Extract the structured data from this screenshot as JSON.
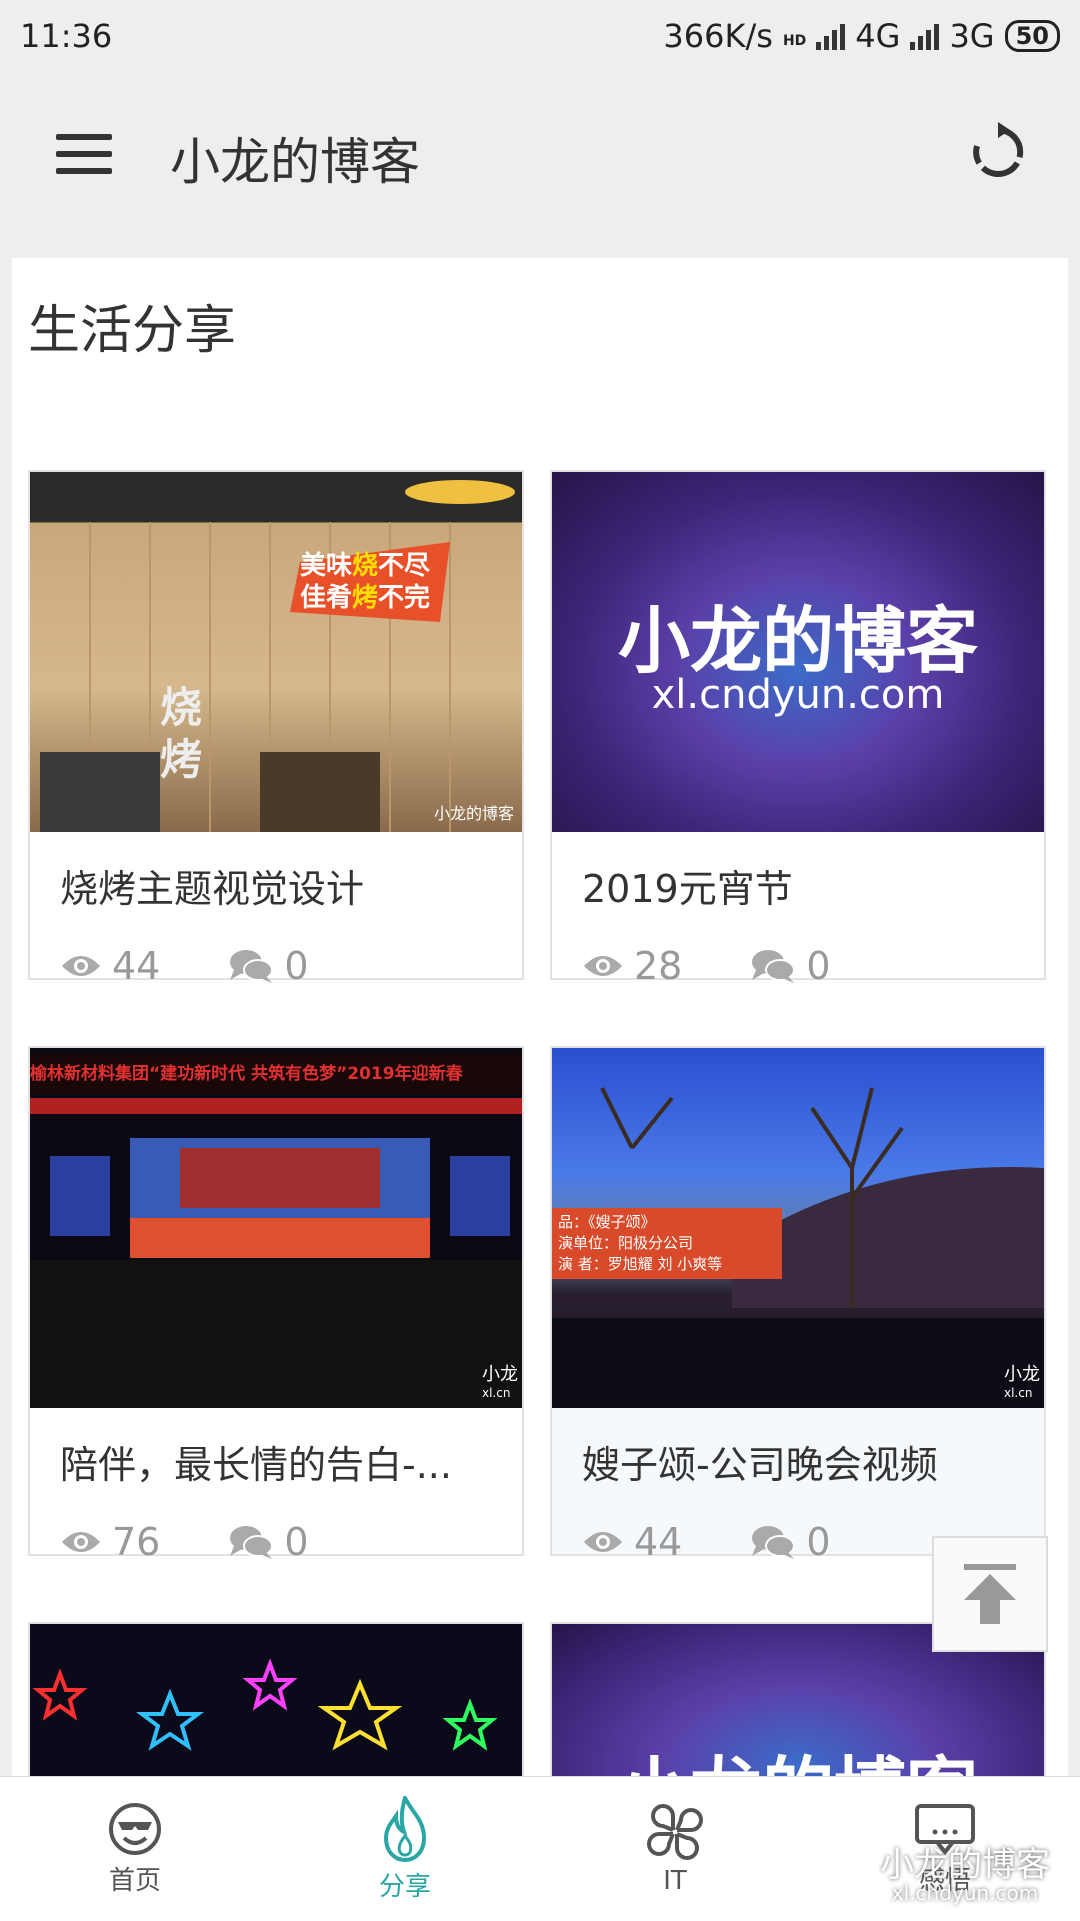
{
  "status_bar": {
    "time": "11:36",
    "speed": "366K/s",
    "hd": "HD",
    "net1": "4G",
    "net2": "3G",
    "battery": "50"
  },
  "toolbar": {
    "title": "小龙的博客",
    "menu_icon": "menu-icon",
    "refresh_icon": "refresh-icon"
  },
  "section": {
    "title": "生活分享"
  },
  "posts": [
    {
      "title": "烧烤主题视觉设计",
      "views": "44",
      "comments": "0",
      "image": {
        "headline_1": "美味",
        "headline_2": "烧",
        "headline_3": "不尽",
        "headline_4": "佳肴",
        "headline_5": "烤",
        "headline_6": "不完",
        "side_1": "烧",
        "side_2": "烤",
        "logo": "小龙的博客"
      }
    },
    {
      "title": "2019元宵节",
      "views": "28",
      "comments": "0",
      "image": {
        "line1": "小龙的博客",
        "line2": "xl.cndyun.com"
      }
    },
    {
      "title": "陪伴，最长情的告白-...",
      "views": "76",
      "comments": "0",
      "image": {
        "banner": "榆林新材料集团“建功新时代 共筑有色梦”2019年迎新春",
        "logo": "小龙",
        "logo_sub": "xl.cn"
      }
    },
    {
      "title": "嫂子颂-公司晚会视频",
      "views": "44",
      "comments": "0",
      "image": {
        "line1": "品：《嫂子颂》",
        "line2": "演单位：阳极分公司",
        "line3": "演 者：罗旭耀 刘 小爽等",
        "logo": "小龙",
        "logo_sub": "xl.cn"
      }
    }
  ],
  "partial_cards": [
    {
      "image": "stars"
    },
    {
      "image": {
        "text": "小龙的博客"
      }
    }
  ],
  "bottom_nav": [
    {
      "label": "首页",
      "icon": "smiley-sunglasses-icon"
    },
    {
      "label": "分享",
      "icon": "flame-icon"
    },
    {
      "label": "IT",
      "icon": "clover-icon"
    },
    {
      "label": "感悟",
      "icon": "chat-box-icon"
    }
  ],
  "watermark": {
    "line1": "小龙的博客",
    "line2": "xl.cndyun.com"
  },
  "colors": {
    "accent": "#2aa6a6",
    "background": "#eeeeee",
    "text": "#333333",
    "muted": "#999999"
  }
}
